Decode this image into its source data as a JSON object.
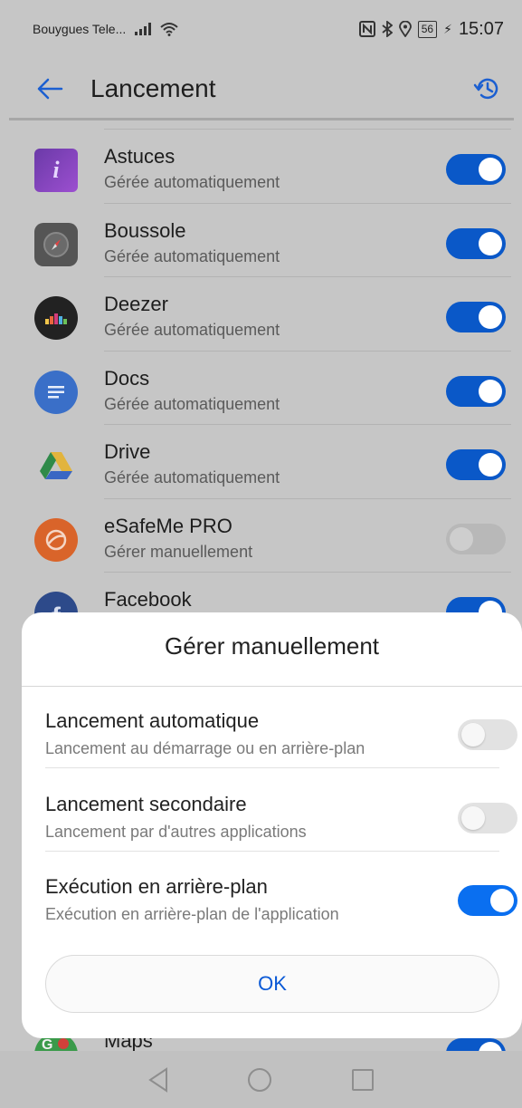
{
  "status_bar": {
    "carrier": "Bouygues Tele...",
    "battery": "56",
    "time": "15:07",
    "icons": [
      "signal-icon",
      "wifi-icon",
      "nfc-icon",
      "bluetooth-icon",
      "location-icon",
      "battery-icon",
      "charging-icon"
    ]
  },
  "app_bar": {
    "title": "Lancement",
    "back_icon": "arrow-left-icon",
    "history_icon": "history-icon"
  },
  "apps": [
    {
      "name": "Astuces",
      "status": "Gérée automatiquement",
      "enabled": true,
      "icon": "astuces-icon"
    },
    {
      "name": "Boussole",
      "status": "Gérée automatiquement",
      "enabled": true,
      "icon": "compass-icon"
    },
    {
      "name": "Deezer",
      "status": "Gérée automatiquement",
      "enabled": true,
      "icon": "deezer-icon"
    },
    {
      "name": "Docs",
      "status": "Gérée automatiquement",
      "enabled": true,
      "icon": "docs-icon"
    },
    {
      "name": "Drive",
      "status": "Gérée automatiquement",
      "enabled": true,
      "icon": "drive-icon"
    },
    {
      "name": "eSafeMe PRO",
      "status": "Gérer manuellement",
      "enabled": false,
      "icon": "esafeme-icon"
    },
    {
      "name": "Facebook",
      "status": "",
      "enabled": true,
      "icon": "facebook-icon"
    },
    {
      "name": "Maps",
      "status": "",
      "enabled": true,
      "icon": "maps-icon"
    }
  ],
  "dialog": {
    "title": "Gérer manuellement",
    "options": [
      {
        "title": "Lancement automatique",
        "subtitle": "Lancement au démarrage ou en arrière-plan",
        "enabled": false
      },
      {
        "title": "Lancement secondaire",
        "subtitle": "Lancement par d'autres applications",
        "enabled": false
      },
      {
        "title": "Exécution en arrière-plan",
        "subtitle": "Exécution en arrière-plan de l'application",
        "enabled": true
      }
    ],
    "ok_label": "OK"
  },
  "nav_bar": {
    "icons": [
      "back-triangle-icon",
      "home-circle-icon",
      "recents-square-icon"
    ]
  },
  "colors": {
    "accent": "#0a58c8",
    "scrim": "#c6c6c6"
  }
}
